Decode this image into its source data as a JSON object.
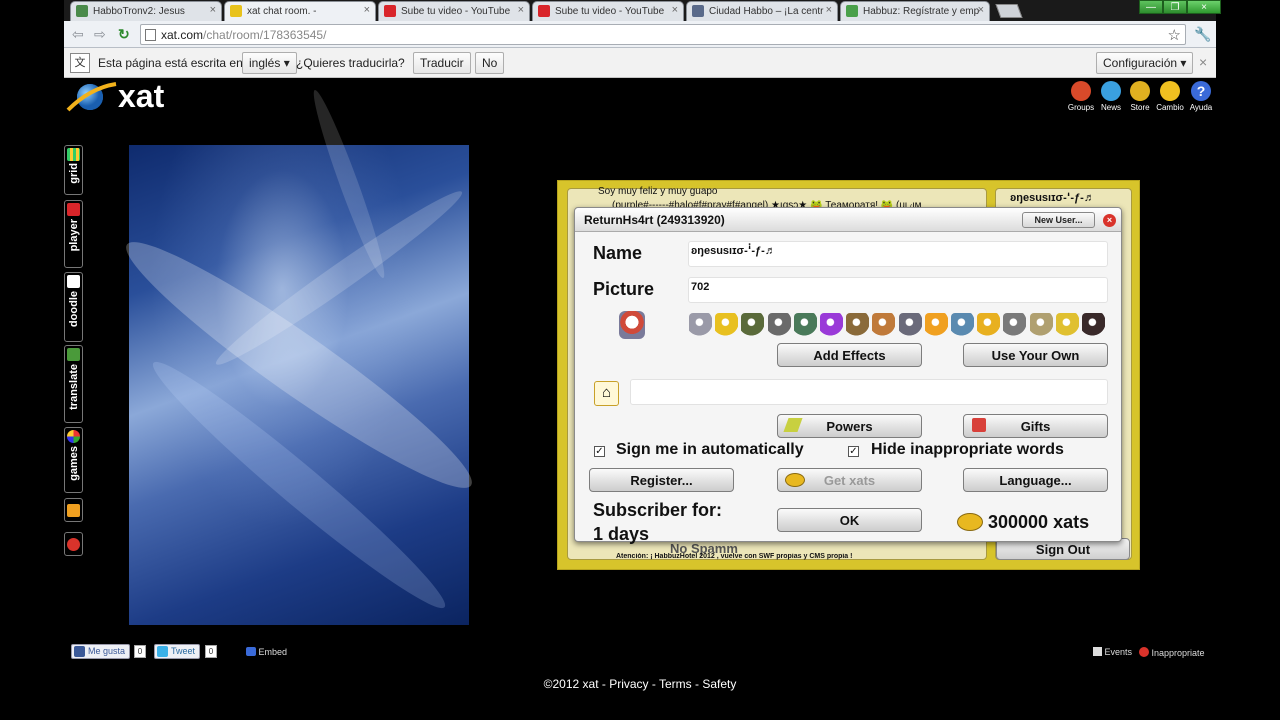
{
  "browser": {
    "tabs": [
      {
        "title": "HabboTronv2: Jesus",
        "icon_color": "#4a8a4a"
      },
      {
        "title": "xat chat room. -",
        "icon_color": "#e8c21b",
        "active": true
      },
      {
        "title": "Sube tu video - YouTube",
        "icon_color": "#d9252a"
      },
      {
        "title": "Sube tu video - YouTube",
        "icon_color": "#d9252a"
      },
      {
        "title": "Ciudad Habbo – ¡La centr",
        "icon_color": "#5a6a8a"
      },
      {
        "title": "Habbuz: Regístrate y emp",
        "icon_color": "#4aa04a"
      }
    ],
    "tab_close": "×",
    "url_domain": "xat.com",
    "url_path": "/chat/room/178363545/",
    "star_icon": "☆"
  },
  "translate_bar": {
    "text1": "Esta página está escrita en",
    "language": "inglés",
    "question": "¿Quieres traducirla?",
    "translate_btn": "Traducir",
    "no_btn": "No",
    "config_btn": "Configuración",
    "close": "×"
  },
  "xat": {
    "logo_text": "xat",
    "header_icons": [
      {
        "label": "Groups",
        "color": "#d84a2a"
      },
      {
        "label": "News",
        "color": "#3aa0e0"
      },
      {
        "label": "Store",
        "color": "#e0b020"
      },
      {
        "label": "Cambio",
        "color": "#f0c020"
      },
      {
        "label": "Ayuda",
        "color": "#3a6ad8"
      }
    ],
    "side_nav": [
      "grid",
      "player",
      "doodle",
      "translate",
      "games"
    ]
  },
  "chat": {
    "lines": [
      "Soy muy feliz y muy guapo",
      "(purple#------#halo#f#pray#f#angel) ★ıqsɔ★ 🐸 Теаморатя! 🐸 (uᴉ ₍ᴉᴍ",
      "No  Spamm",
      "Atención: ¡ HabbuzHotel 2012 , vuelve con SWF propias y CMS propia !"
    ],
    "user_top": "ʚŋesusıɪσ-ꜞ-ƒ-♬",
    "signout": "Sign Out"
  },
  "dialog": {
    "title": "ReturnHs4rt (249313920)",
    "new_user": "New User...",
    "close": "×",
    "name_label": "Name",
    "name_value": "ʚŋesusıɪσ-ꜞ-ƒ-♬",
    "picture_label": "Picture",
    "picture_value": "702",
    "add_effects": "Add Effects",
    "use_your_own": "Use Your Own",
    "homepage_value": "",
    "powers": "Powers",
    "gifts": "Gifts",
    "sign_in_auto": "Sign me in automatically",
    "hide_words": "Hide inappropriate words",
    "check_mark": "✓",
    "register": "Register...",
    "get_xats": "Get xats",
    "language": "Language...",
    "subscriber_label": "Subscriber for:",
    "subscriber_days": "1 days",
    "ok": "OK",
    "xats": "300000 xats",
    "smiley_colors": [
      "#9a9aa8",
      "#e8c020",
      "#5a6a3a",
      "#6a6a6a",
      "#4a7a5a",
      "#9a3ad8",
      "#8a6a3a",
      "#c07a3a",
      "#6a6a7a",
      "#f0a020",
      "#5a8ab0",
      "#e8b020",
      "#7a7a7a",
      "#b0a070",
      "#e0c030",
      "#3a2a2a"
    ]
  },
  "footer": {
    "like": "Me gusta",
    "like_count": "0",
    "tweet": "Tweet",
    "tweet_count": "0",
    "embed": "Embed",
    "events": "Events",
    "inappropriate": "Inappropriate",
    "copyright": "©2012 xat - Privacy - Terms - Safety"
  }
}
